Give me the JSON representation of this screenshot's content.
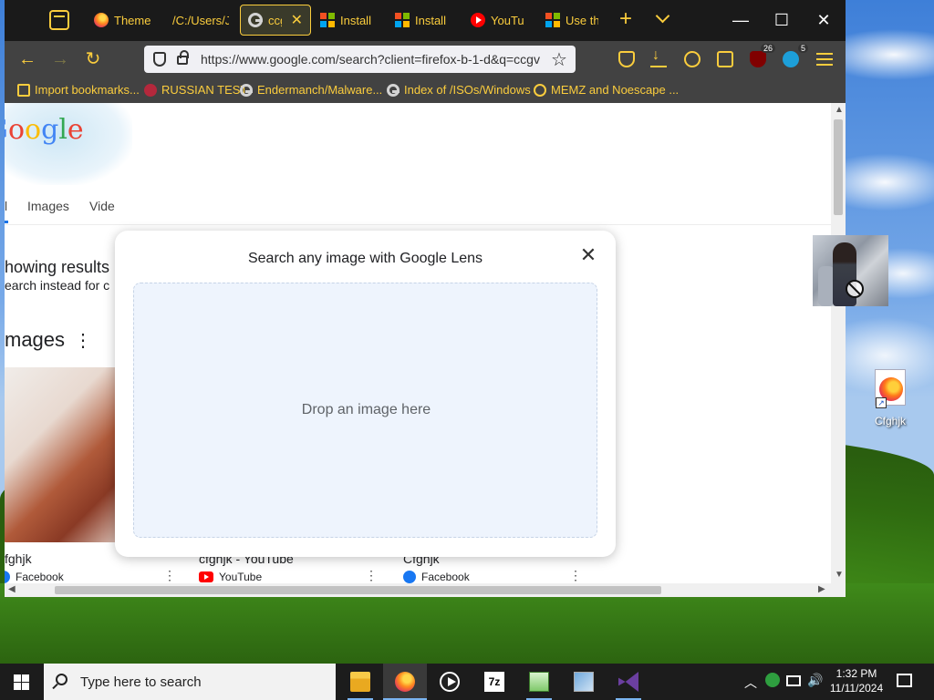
{
  "browser": {
    "tabs": [
      {
        "title": "Theme",
        "icon": "firefox-icon"
      },
      {
        "title": "/C:/Users/J",
        "icon": ""
      },
      {
        "title": "ccgv",
        "icon": "google-icon",
        "active": true
      },
      {
        "title": "Install",
        "icon": "microsoft-icon"
      },
      {
        "title": "Install",
        "icon": "microsoft-icon"
      },
      {
        "title": "YouTu",
        "icon": "youtube-icon"
      },
      {
        "title": "Use th",
        "icon": "microsoft-icon"
      }
    ],
    "new_tab": "+",
    "window_controls": {
      "minimize": "—",
      "maximize": "☐",
      "close": "✕"
    },
    "url": "https://www.google.com/search?client=firefox-b-1-d&q=ccgv",
    "toolbar_badges": {
      "ublock": "26",
      "blue_ext": "5"
    },
    "bookmarks": [
      {
        "label": "Import bookmarks...",
        "icon": "import-icon"
      },
      {
        "label": "RUSSIAN TEST",
        "icon": "red-circle-icon"
      },
      {
        "label": "Endermanch/Malware...",
        "icon": "google-icon"
      },
      {
        "label": "Index of /ISOs/Windows",
        "icon": "google-icon"
      },
      {
        "label": "MEMZ and Noescape ...",
        "icon": "globe-icon"
      }
    ],
    "accent_color": "#fbcd3d"
  },
  "page": {
    "logo_letters": [
      "G",
      "o",
      "o",
      "g",
      "l",
      "e"
    ],
    "tabs": {
      "all": "l",
      "images": "Images",
      "videos": "Vide"
    },
    "showing_results": "howing results",
    "search_instead": "earch instead for c",
    "images_heading": "mages",
    "images_menu": "⋮",
    "results": [
      {
        "title": "fghjk",
        "source": "Facebook",
        "source_icon": "facebook-icon"
      },
      {
        "title": "cfghjk - YouTube",
        "source": "YouTube",
        "source_icon": "youtube-icon"
      },
      {
        "title": "Cfghjk",
        "source": "Facebook",
        "source_icon": "facebook-icon"
      }
    ],
    "result_menu": "⋮"
  },
  "lens_dialog": {
    "title": "Search any image with Google Lens",
    "close": "✕",
    "drop_text": "Drop an image here"
  },
  "desktop": {
    "icon_label": "Cfghjk"
  },
  "taskbar": {
    "search_placeholder": "Type here to search",
    "time": "1:32 PM",
    "date": "11/11/2024",
    "apps": [
      "file-explorer",
      "firefox",
      "media-player",
      "7zip",
      "notepad-plus-plus",
      "control-panel",
      "visual-studio"
    ]
  }
}
